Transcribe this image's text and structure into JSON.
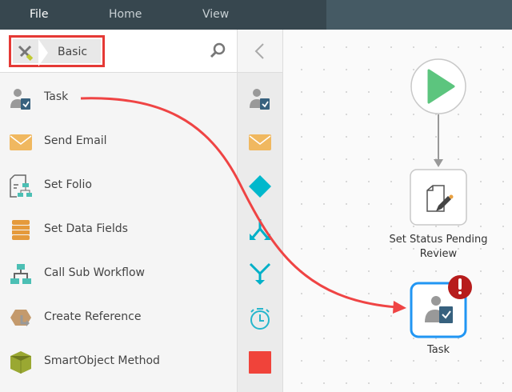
{
  "menu": {
    "file": "File",
    "home": "Home",
    "view": "View"
  },
  "breadcrumb": {
    "label": "Basic"
  },
  "toolbox": {
    "items": [
      {
        "label": "Task",
        "icon": "task-icon"
      },
      {
        "label": "Send Email",
        "icon": "email-icon"
      },
      {
        "label": "Set Folio",
        "icon": "folio-icon"
      },
      {
        "label": "Set Data Fields",
        "icon": "data-fields-icon"
      },
      {
        "label": "Call Sub Workflow",
        "icon": "sub-workflow-icon"
      },
      {
        "label": "Create Reference",
        "icon": "reference-icon"
      },
      {
        "label": "SmartObject Method",
        "icon": "smartobject-icon"
      }
    ]
  },
  "canvas": {
    "nodes": [
      {
        "label": "Set Status Pending Review"
      },
      {
        "label": "Task"
      }
    ]
  },
  "colors": {
    "accent": "#2196f3",
    "error": "#b71c1c",
    "start": "#5cc57e",
    "arrow": "#ef4444"
  }
}
